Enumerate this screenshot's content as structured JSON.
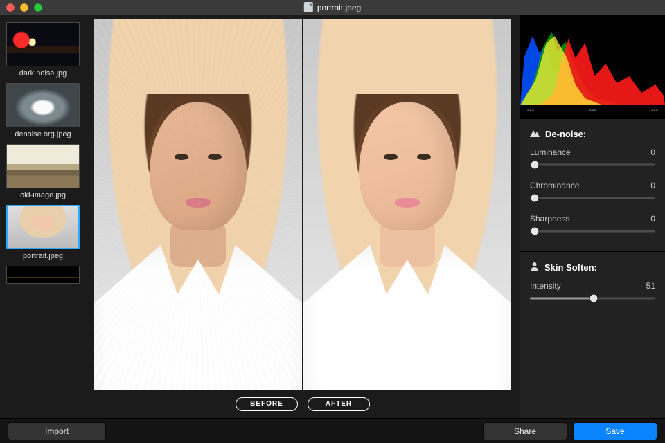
{
  "window_title": "portrait.jpeg",
  "sidebar": {
    "items": [
      {
        "label": "dark noise.jpg",
        "thumb": "th-night",
        "selected": false
      },
      {
        "label": "denoise org.jpeg",
        "thumb": "th-bird",
        "selected": false
      },
      {
        "label": "old-image.jpg",
        "thumb": "th-old",
        "selected": false
      },
      {
        "label": "portrait.jpeg",
        "thumb": "th-portrait",
        "selected": true
      },
      {
        "label": "",
        "thumb": "th-dark",
        "selected": false
      }
    ]
  },
  "compare": {
    "before_label": "BEFORE",
    "after_label": "AFTER"
  },
  "readouts": {
    "a": "---",
    "b": "---",
    "c": "---"
  },
  "denoise": {
    "heading": "De-noise:",
    "luminance": {
      "label": "Luminance",
      "value": 0
    },
    "chrominance": {
      "label": "Chrominance",
      "value": 0
    },
    "sharpness": {
      "label": "Sharpness",
      "value": 0
    }
  },
  "skin": {
    "heading": "Skin Soften:",
    "intensity": {
      "label": "Intensity",
      "value": 51
    }
  },
  "buttons": {
    "import": "Import",
    "share": "Share",
    "save": "Save"
  }
}
